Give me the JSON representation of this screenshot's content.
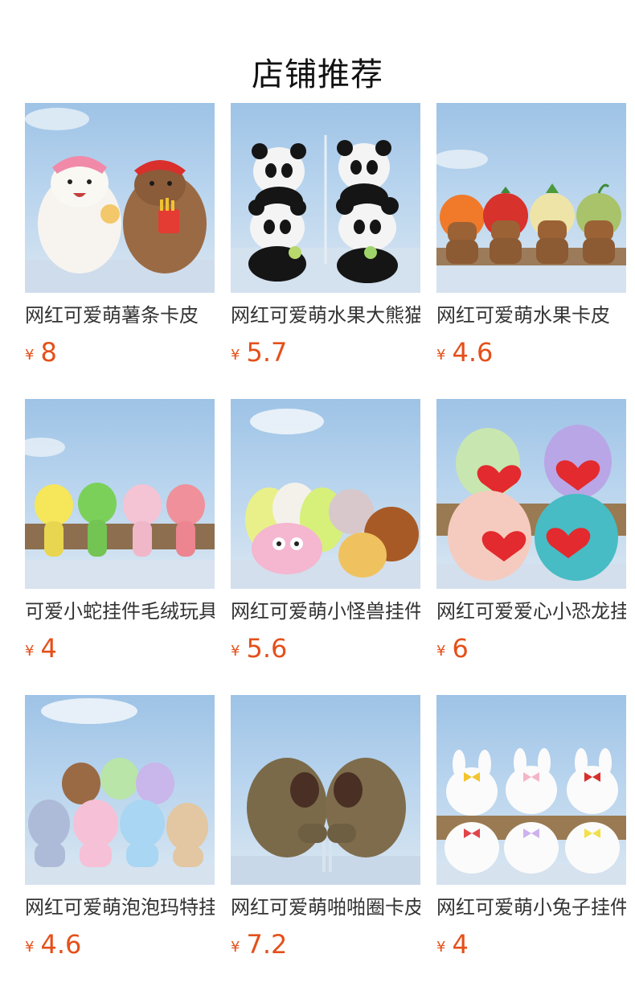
{
  "page": {
    "title": "店铺推荐",
    "currency_symbol": "¥"
  },
  "products": [
    {
      "name": "网红可爱萌薯条卡皮",
      "price": "8",
      "image": "capybara-fries-plush"
    },
    {
      "name": "网红可爱萌水果大熊猫",
      "price": "5.7",
      "image": "fruit-panda-plush"
    },
    {
      "name": "网红可爱萌水果卡皮",
      "price": "4.6",
      "image": "fruit-capybara-plush"
    },
    {
      "name": "可爱小蛇挂件毛绒玩具",
      "price": "4",
      "image": "snake-pendant-plush"
    },
    {
      "name": "网红可爱萌小怪兽挂件",
      "price": "5.6",
      "image": "little-monster-plush"
    },
    {
      "name": "网红可爱爱心小恐龙挂",
      "price": "6",
      "image": "heart-dinosaur-plush"
    },
    {
      "name": "网红可爱萌泡泡玛特挂",
      "price": "4.6",
      "image": "bubble-doll-plush"
    },
    {
      "name": "网红可爱萌啪啪圈卡皮",
      "price": "7.2",
      "image": "slap-band-capybara-plush"
    },
    {
      "name": "网红可爱萌小兔子挂件",
      "price": "4",
      "image": "bunny-pendant-plush"
    }
  ]
}
